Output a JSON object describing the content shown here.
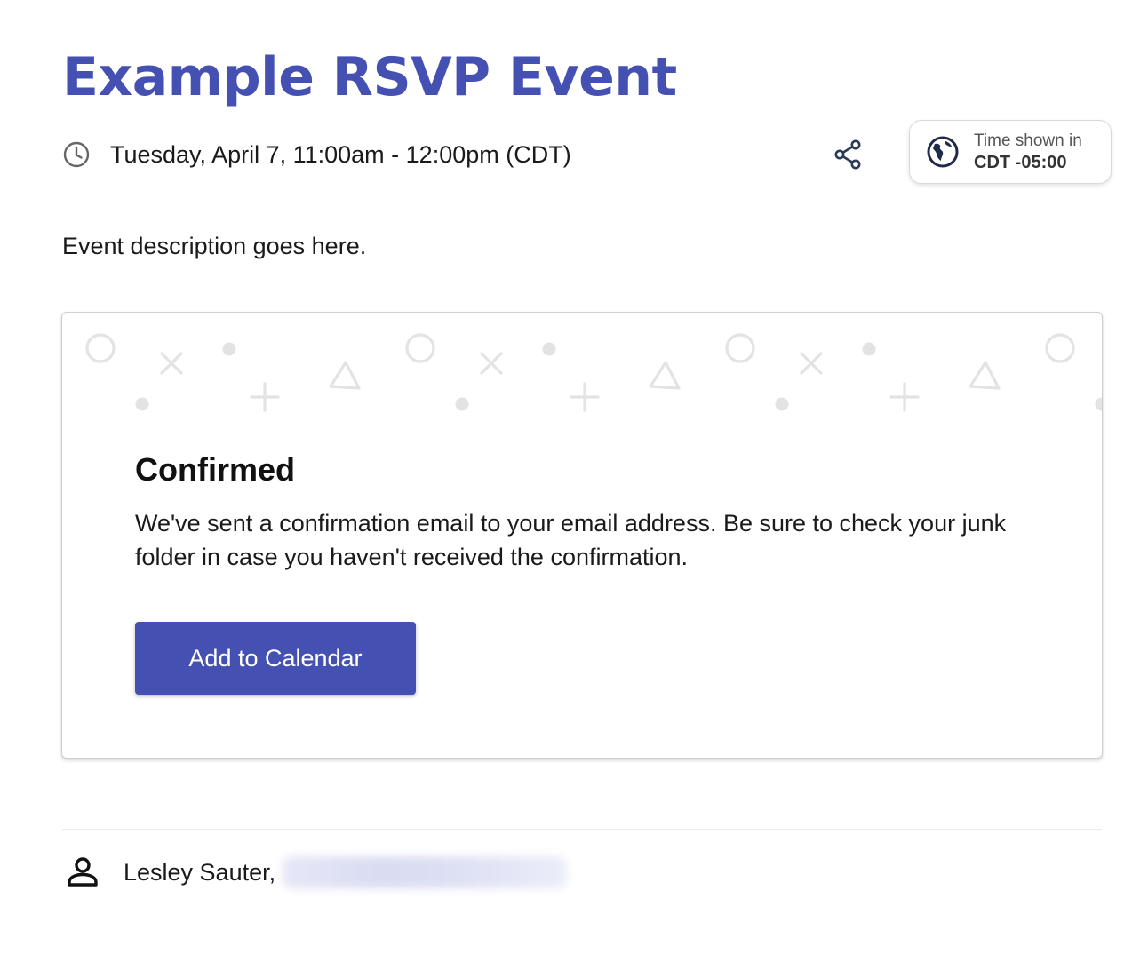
{
  "event": {
    "title": "Example RSVP Event",
    "datetime": "Tuesday, April 7, 11:00am - 12:00pm (CDT)",
    "description": "Event description goes here."
  },
  "timezone": {
    "caption": "Time shown in",
    "value": "CDT -05:00"
  },
  "confirmation": {
    "title": "Confirmed",
    "message": "We've sent a confirmation email to your email address. Be sure to check your junk folder in case you haven't received the confirmation.",
    "button_label": "Add to Calendar"
  },
  "attendee": {
    "name": "Lesley Sauter,",
    "email_redacted": true
  },
  "icons": {
    "datetime": "clock-icon",
    "share": "share-icon",
    "timezone": "globe-icon",
    "attendee": "person-icon"
  },
  "colors": {
    "accent": "#4451b3",
    "text": "#1a1a1a",
    "pattern": "#e3e3e3"
  }
}
